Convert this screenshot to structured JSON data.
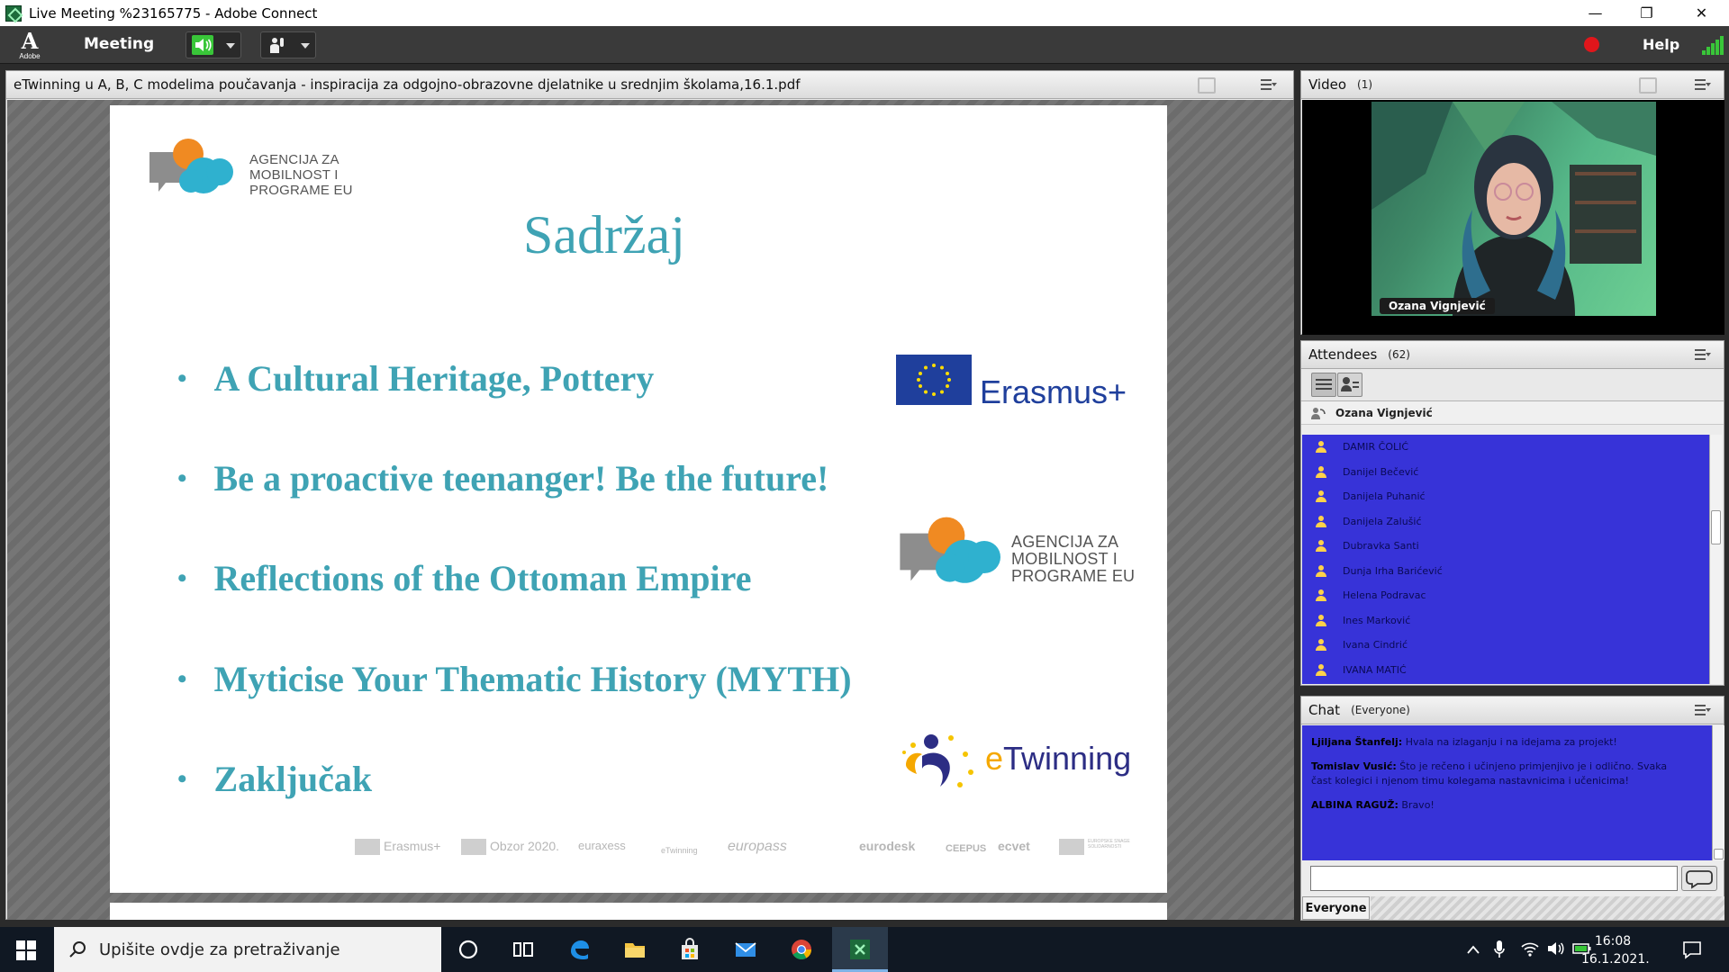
{
  "window": {
    "title": "Live Meeting %23165775 - Adobe Connect",
    "controls": [
      "—",
      "❐",
      "✕"
    ]
  },
  "toolbar": {
    "logo_letter": "A",
    "logo_sub": "Adobe",
    "menu_meeting": "Meeting",
    "help": "Help",
    "accent_green": "#39c639",
    "record_color": "#e0161b"
  },
  "share": {
    "filename": "eTwinning u A, B, C modelima poučavanja - inspiracija za odgojno-obrazovne djelatnike u srednjim školama,16.1.pdf",
    "slide": {
      "agency_lines": [
        "AGENCIJA ZA",
        "MOBILNOST I",
        "PROGRAME EU"
      ],
      "title": "Sadržaj",
      "bullets": [
        "A Cultural Heritage, Pottery",
        "Be a proactive teenanger! Be the future!",
        "Reflections of the Ottoman Empire",
        "Myticise Your Thematic History (MYTH)",
        "Zaključak"
      ],
      "erasmus": "Erasmus+",
      "etwinning_e": "e",
      "etwinning_rest": "Twinning",
      "footer_logos": [
        "Erasmus+",
        "Obzor 2020.",
        "euraxess",
        "eTwinning",
        "europass",
        "eurodesk",
        "CEEPUS",
        "ecvet",
        "EUROPSKE SNAGE SOLIDARNOSTI"
      ],
      "title_color": "#3fa3b4"
    }
  },
  "video": {
    "title": "Video",
    "count": "(1)",
    "presenter": "Ozana Vignjević"
  },
  "attendees": {
    "title": "Attendees",
    "count": "(62)",
    "host": "Ozana Vignjević",
    "list": [
      "DAMIR ČOLIĆ",
      "Danijel Bečević",
      "Danijela Puhanić",
      "Danijela Zalušić",
      "Dubravka Santi",
      "Dunja Irha Barićević",
      "Helena Podravac",
      "Ines Marković",
      "Ivana Cindrić",
      "IVANA MATIĆ"
    ]
  },
  "chat": {
    "title": "Chat",
    "scope": "(Everyone)",
    "messages": [
      {
        "author": "Ljiljana Štanfelj:",
        "text": "Hvala na izlaganju i na idejama za projekt!"
      },
      {
        "author": "Tomislav Vusić:",
        "text": "Što je rečeno i učinjeno primjenjivo je i odlično. Svaka čast kolegici i njenom timu kolegama nastavnicima i učenicima!"
      },
      {
        "author": "ALBINA RAGUŽ:",
        "text": "Bravo!"
      }
    ],
    "audience_button": "Everyone"
  },
  "taskbar": {
    "search_placeholder": "Upišite ovdje za pretraživanje",
    "time": "16:08",
    "date": "16.1.2021."
  }
}
